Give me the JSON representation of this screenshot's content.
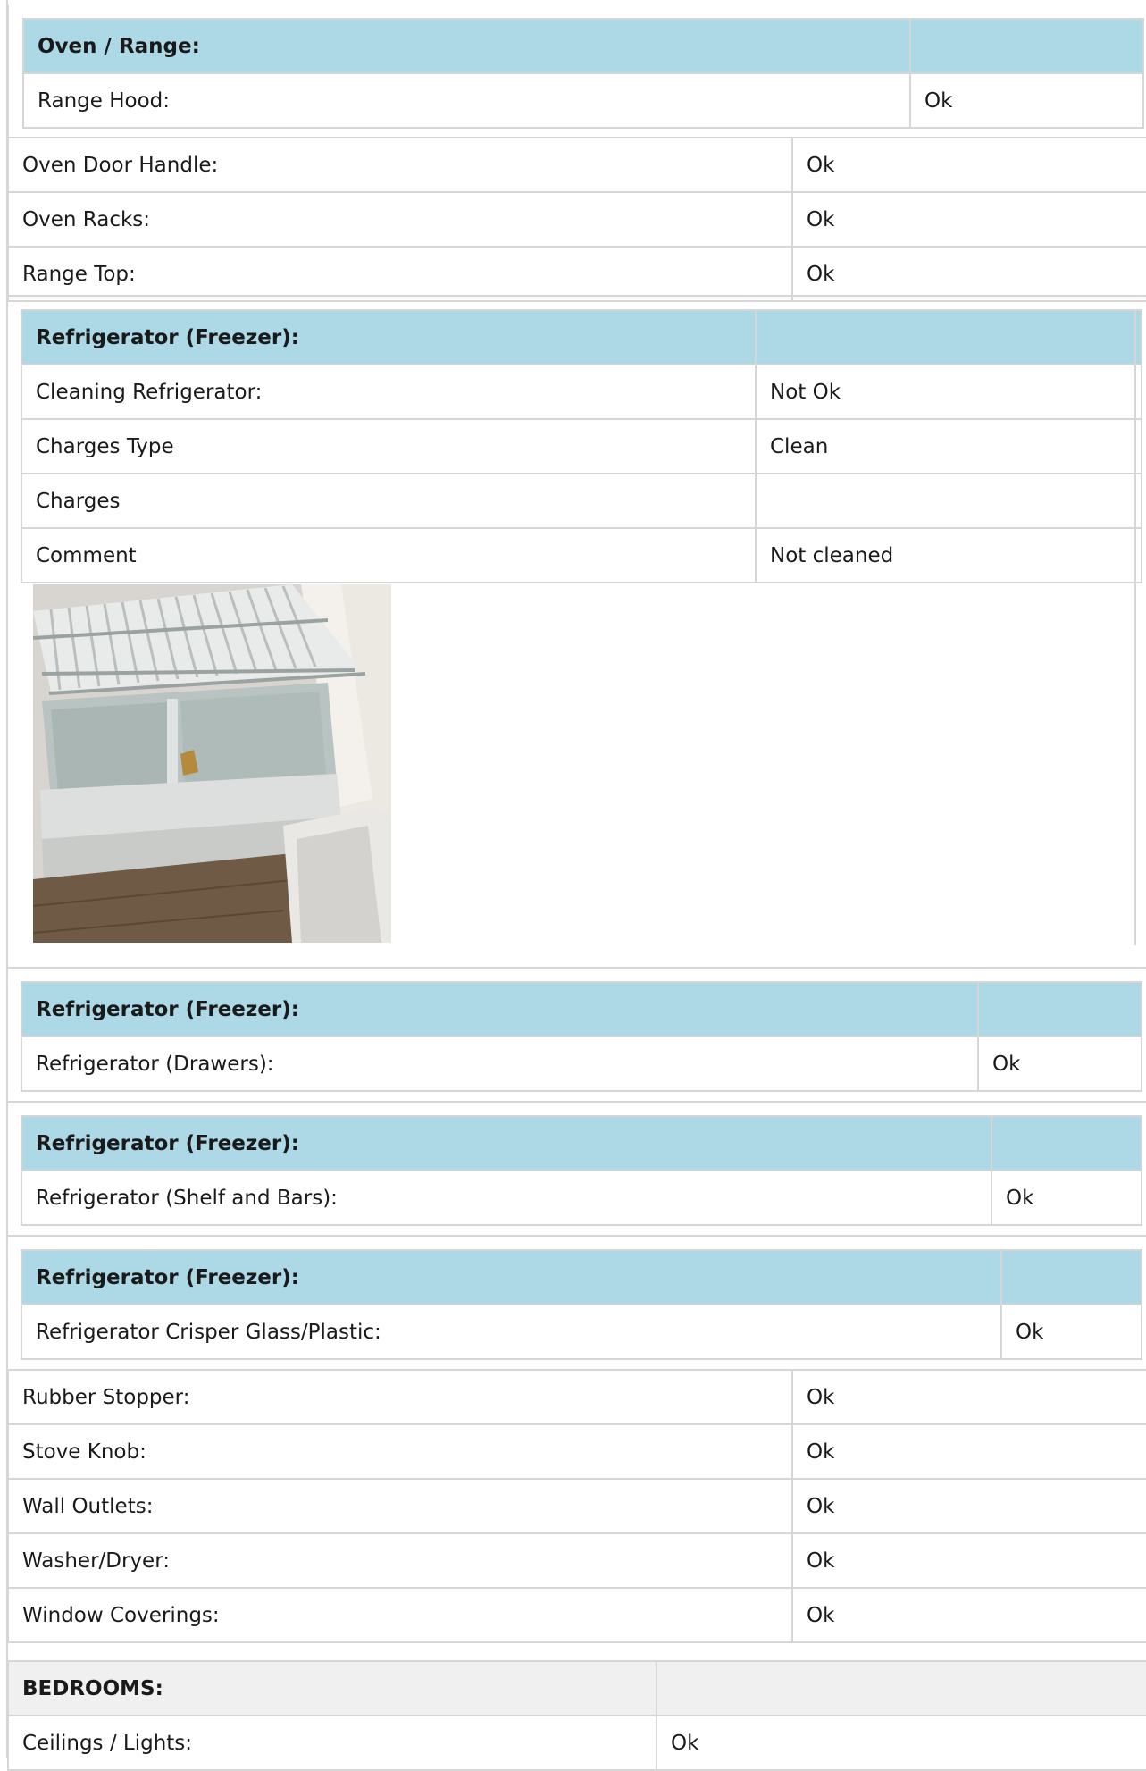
{
  "oven_range": {
    "header": "Oven / Range:",
    "rows": [
      {
        "label": "Range Hood:",
        "value": "Ok"
      }
    ]
  },
  "oven_items": [
    {
      "label": "Oven Door Handle:",
      "value": "Ok"
    },
    {
      "label": "Oven Racks:",
      "value": "Ok"
    },
    {
      "label": "Range Top:",
      "value": "Ok"
    }
  ],
  "refrigerator_cleaning": {
    "header": "Refrigerator (Freezer):",
    "rows": [
      {
        "label": "Cleaning Refrigerator:",
        "value": "Not Ok"
      },
      {
        "label": "Charges Type",
        "value": "Clean"
      },
      {
        "label": "Charges",
        "value": ""
      },
      {
        "label": "Comment",
        "value": "Not cleaned"
      }
    ],
    "photo_alt": "refrigerator interior photo"
  },
  "refrigerator_drawers": {
    "header": "Refrigerator (Freezer):",
    "rows": [
      {
        "label": "Refrigerator (Drawers):",
        "value": "Ok"
      }
    ]
  },
  "refrigerator_shelf": {
    "header": "Refrigerator (Freezer):",
    "rows": [
      {
        "label": "Refrigerator (Shelf and Bars):",
        "value": "Ok"
      }
    ]
  },
  "refrigerator_crisper": {
    "header": "Refrigerator (Freezer):",
    "rows": [
      {
        "label": "Refrigerator Crisper Glass/Plastic:",
        "value": "Ok"
      }
    ]
  },
  "misc_items": [
    {
      "label": "Rubber Stopper:",
      "value": "Ok"
    },
    {
      "label": "Stove Knob:",
      "value": "Ok"
    },
    {
      "label": "Wall Outlets:",
      "value": "Ok"
    },
    {
      "label": "Washer/Dryer:",
      "value": "Ok"
    },
    {
      "label": "Window Coverings:",
      "value": "Ok"
    }
  ],
  "bedrooms": {
    "header": "BEDROOMS:",
    "rows": [
      {
        "label": "Ceilings / Lights:",
        "value": "Ok"
      }
    ]
  },
  "colors": {
    "section_header": "#add8e6",
    "room_header": "#f0f0f0",
    "border": "#d6d6d6"
  }
}
